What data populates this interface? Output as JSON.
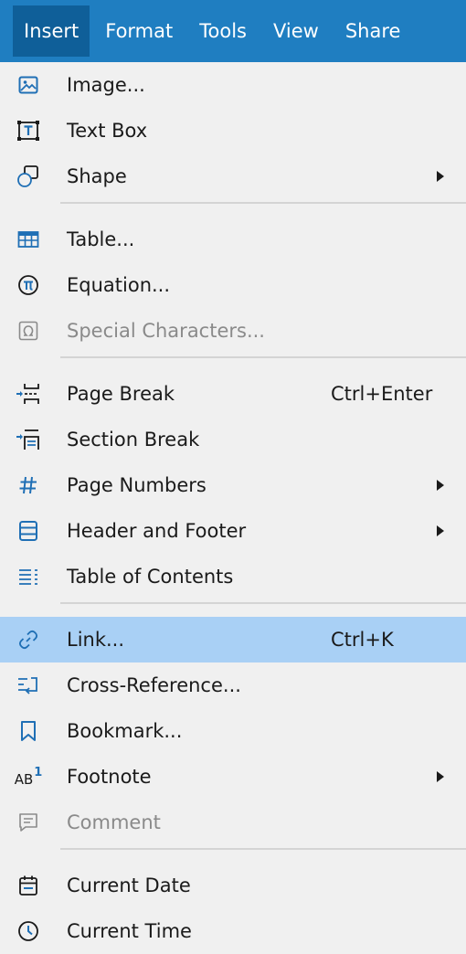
{
  "menubar": {
    "tabs": [
      "Insert",
      "Format",
      "Tools",
      "View",
      "Share"
    ],
    "active": "Insert"
  },
  "colors": {
    "menubar_bg": "#1f7ec1",
    "active_tab_bg": "#0f5f99",
    "icon_blue": "#1f6fb5",
    "highlight": "#a9d0f5",
    "disabled_text": "#8a8a8a"
  },
  "menu": {
    "image": {
      "label": "Image...",
      "icon": "image-icon"
    },
    "text_box": {
      "label": "Text Box",
      "icon": "text-box-icon"
    },
    "shape": {
      "label": "Shape",
      "icon": "shape-icon",
      "submenu": true
    },
    "table": {
      "label": "Table...",
      "icon": "table-icon"
    },
    "equation": {
      "label": "Equation...",
      "icon": "pi-icon"
    },
    "special_characters": {
      "label": "Special Characters...",
      "icon": "omega-icon",
      "disabled": true
    },
    "page_break": {
      "label": "Page Break",
      "shortcut": "Ctrl+Enter",
      "icon": "page-break-icon"
    },
    "section_break": {
      "label": "Section Break",
      "icon": "section-break-icon"
    },
    "page_numbers": {
      "label": "Page Numbers",
      "icon": "hash-icon",
      "submenu": true
    },
    "header_footer": {
      "label": "Header and Footer",
      "icon": "header-footer-icon",
      "submenu": true
    },
    "toc": {
      "label": "Table of Contents",
      "icon": "toc-icon"
    },
    "link": {
      "label": "Link...",
      "shortcut": "Ctrl+K",
      "icon": "link-icon",
      "highlighted": true
    },
    "cross_reference": {
      "label": "Cross-Reference...",
      "icon": "cross-reference-icon"
    },
    "bookmark": {
      "label": "Bookmark...",
      "icon": "bookmark-icon"
    },
    "footnote": {
      "label": "Footnote",
      "icon": "footnote-icon",
      "icon_text": "AB",
      "icon_sup": "1",
      "submenu": true
    },
    "comment": {
      "label": "Comment",
      "icon": "comment-icon",
      "disabled": true
    },
    "current_date": {
      "label": "Current Date",
      "icon": "calendar-icon"
    },
    "current_time": {
      "label": "Current Time",
      "icon": "clock-icon"
    }
  }
}
